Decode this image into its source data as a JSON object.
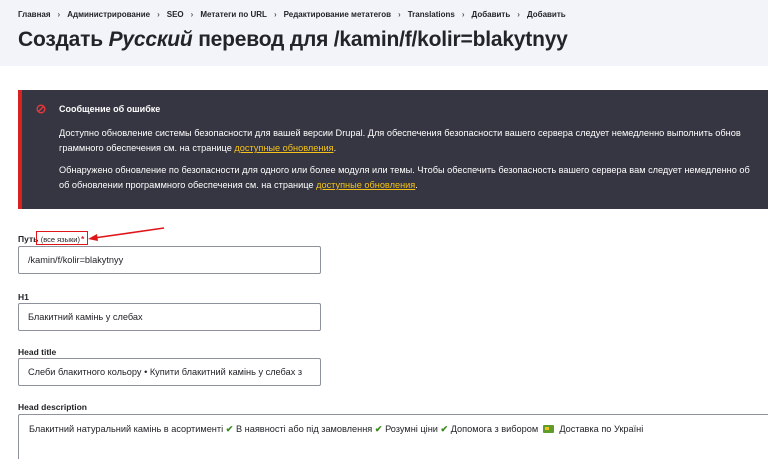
{
  "breadcrumb": [
    "Главная",
    "Администрирование",
    "SEO",
    "Метатеги по URL",
    "Редактирование метатегов",
    "Translations",
    "Добавить",
    "Добавить"
  ],
  "page_title": {
    "prefix": "Создать",
    "language": "Русский",
    "suffix": "перевод для /kamin/f/kolir=blakytnyy"
  },
  "error_message": {
    "title": "Сообщение об ошибке",
    "p1_text": "Доступно обновление системы безопасности для вашей версии Drupal. Для обеспечения безопасности вашего сервера следует немедленно выполнить обнов",
    "p1_line2": "граммного обеспечения см. на странице",
    "p1_link": "доступные обновления",
    "p2_text": "Обнаружено обновление по безопасности для одного или более модуля или темы. Чтобы обеспечить безопасность вашего сервера вам следует немедленно об",
    "p2_line2": "об обновлении программного обеспечения см. на странице",
    "p2_link": "доступные обновления"
  },
  "fields": {
    "path_label": "Путь",
    "path_note": "(все языки)",
    "path_required": "*",
    "path_value": "/kamin/f/kolir=blakytnyy",
    "h1_label": "H1",
    "h1_value": "Блакитний камінь у слебах",
    "head_title_label": "Head title",
    "head_title_value": "Слеби блакитного кольору • Купити блакитний камінь у слебах з",
    "head_description_label": "Head description",
    "head_description_parts": [
      "Блакитний натуральний камінь в асортименті",
      "В наявності або під замовлення",
      "Розумні ціни",
      "Допомога з вибором",
      "Доставка по Україні"
    ]
  },
  "colors": {
    "error_border": "#d72222",
    "message_bg": "#353641",
    "link": "#f5c21b",
    "annotation": "#e1161a",
    "check": "#3d8b1f"
  }
}
